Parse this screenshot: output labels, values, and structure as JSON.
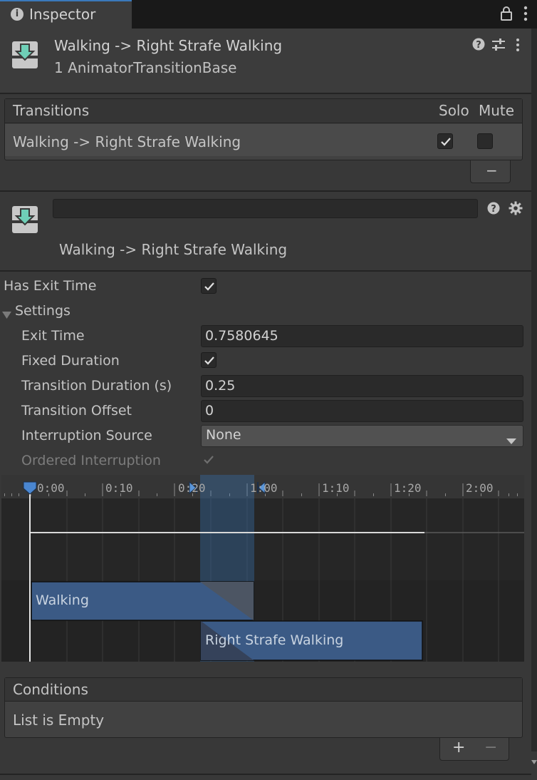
{
  "tab": {
    "label": "Inspector"
  },
  "header": {
    "title": "Walking -> Right Strafe Walking",
    "subtitle": "1 AnimatorTransitionBase"
  },
  "transitions": {
    "header": "Transitions",
    "solo_label": "Solo",
    "mute_label": "Mute",
    "rows": [
      {
        "name": "Walking -> Right Strafe Walking",
        "solo": true,
        "mute": false
      }
    ],
    "remove_label": "−"
  },
  "transition_header": {
    "name_value": "",
    "label": "Walking -> Right Strafe Walking"
  },
  "props": {
    "has_exit_time": "Has Exit Time",
    "settings": "Settings",
    "exit_time_label": "Exit Time",
    "exit_time_value": "0.7580645",
    "fixed_duration_label": "Fixed Duration",
    "transition_duration_label": "Transition Duration (s)",
    "transition_duration_value": "0.25",
    "transition_offset_label": "Transition Offset",
    "transition_offset_value": "0",
    "interruption_source_label": "Interruption Source",
    "interruption_source_value": "None",
    "ordered_interruption_label": "Ordered Interruption"
  },
  "timeline": {
    "ticks": [
      "0:00",
      "0:10",
      "0:20",
      "1:00",
      "1:10",
      "1:20",
      "2:00"
    ],
    "source_clip": "Walking",
    "dest_clip": "Right Strafe Walking"
  },
  "conditions": {
    "header": "Conditions",
    "empty": "List is Empty",
    "add_label": "+",
    "remove_label": "−"
  },
  "colors": {
    "accent": "#3a79bb",
    "clip_blue": "#3b5a85",
    "teal": "#6fcfb7"
  }
}
